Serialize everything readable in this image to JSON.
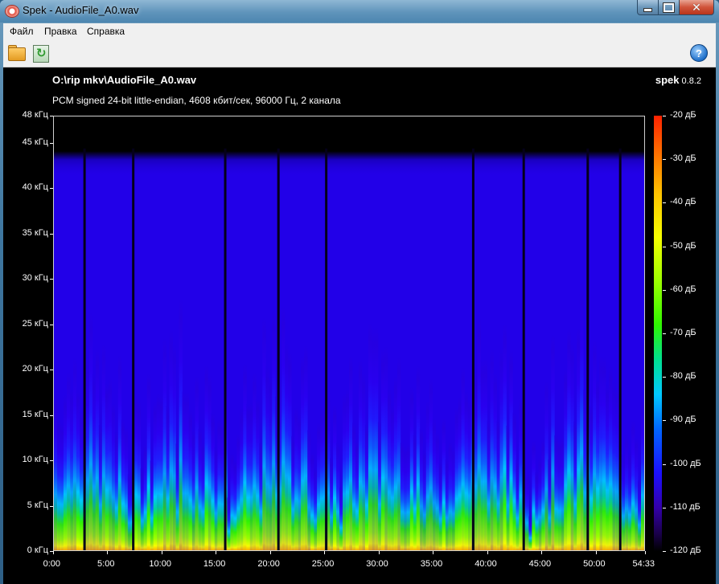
{
  "window": {
    "title": "Spek - AudioFile_A0.wav",
    "close_glyph": "✕"
  },
  "menu": {
    "items": [
      "Файл",
      "Правка",
      "Справка"
    ]
  },
  "toolbar": {
    "open_icon": "folder-open-icon",
    "save_icon": "save-icon",
    "help_icon": "help-icon",
    "help_glyph": "?"
  },
  "header": {
    "file_path": "O:\\rip mkv\\AudioFile_A0.wav",
    "file_info": "PCM signed 24-bit little-endian, 4608 кбит/сек, 96000 Гц, 2 канала",
    "app_name": "spek",
    "app_version": "0.8.2"
  },
  "axes": {
    "freq_labels": [
      "48 кГц",
      "45 кГц",
      "40 кГц",
      "35 кГц",
      "30 кГц",
      "25 кГц",
      "20 кГц",
      "15 кГц",
      "10 кГц",
      "5 кГц",
      "0 кГц"
    ],
    "freq_values": [
      48,
      45,
      40,
      35,
      30,
      25,
      20,
      15,
      10,
      5,
      0
    ],
    "time_labels": [
      "0:00",
      "5:00",
      "10:00",
      "15:00",
      "20:00",
      "25:00",
      "30:00",
      "35:00",
      "40:00",
      "45:00",
      "50:00",
      "54:33"
    ],
    "time_values_sec": [
      0,
      300,
      600,
      900,
      1200,
      1500,
      1800,
      2100,
      2400,
      2700,
      3000,
      3273
    ],
    "duration_sec": 3273,
    "max_freq_khz": 48
  },
  "colorbar": {
    "db_labels": [
      "-20 дБ",
      "-30 дБ",
      "-40 дБ",
      "-50 дБ",
      "-60 дБ",
      "-70 дБ",
      "-80 дБ",
      "-90 дБ",
      "-100 дБ",
      "-110 дБ",
      "-120 дБ"
    ],
    "db_values": [
      -20,
      -30,
      -40,
      -50,
      -60,
      -70,
      -80,
      -90,
      -100,
      -110,
      -120
    ]
  },
  "colors": {
    "background": "#000000",
    "spectrum_floor": "#2200e8",
    "spectrum_mid": "#00c8ff",
    "spectrum_hot": "#2ef500",
    "spectrum_peak": "#ffc400"
  }
}
